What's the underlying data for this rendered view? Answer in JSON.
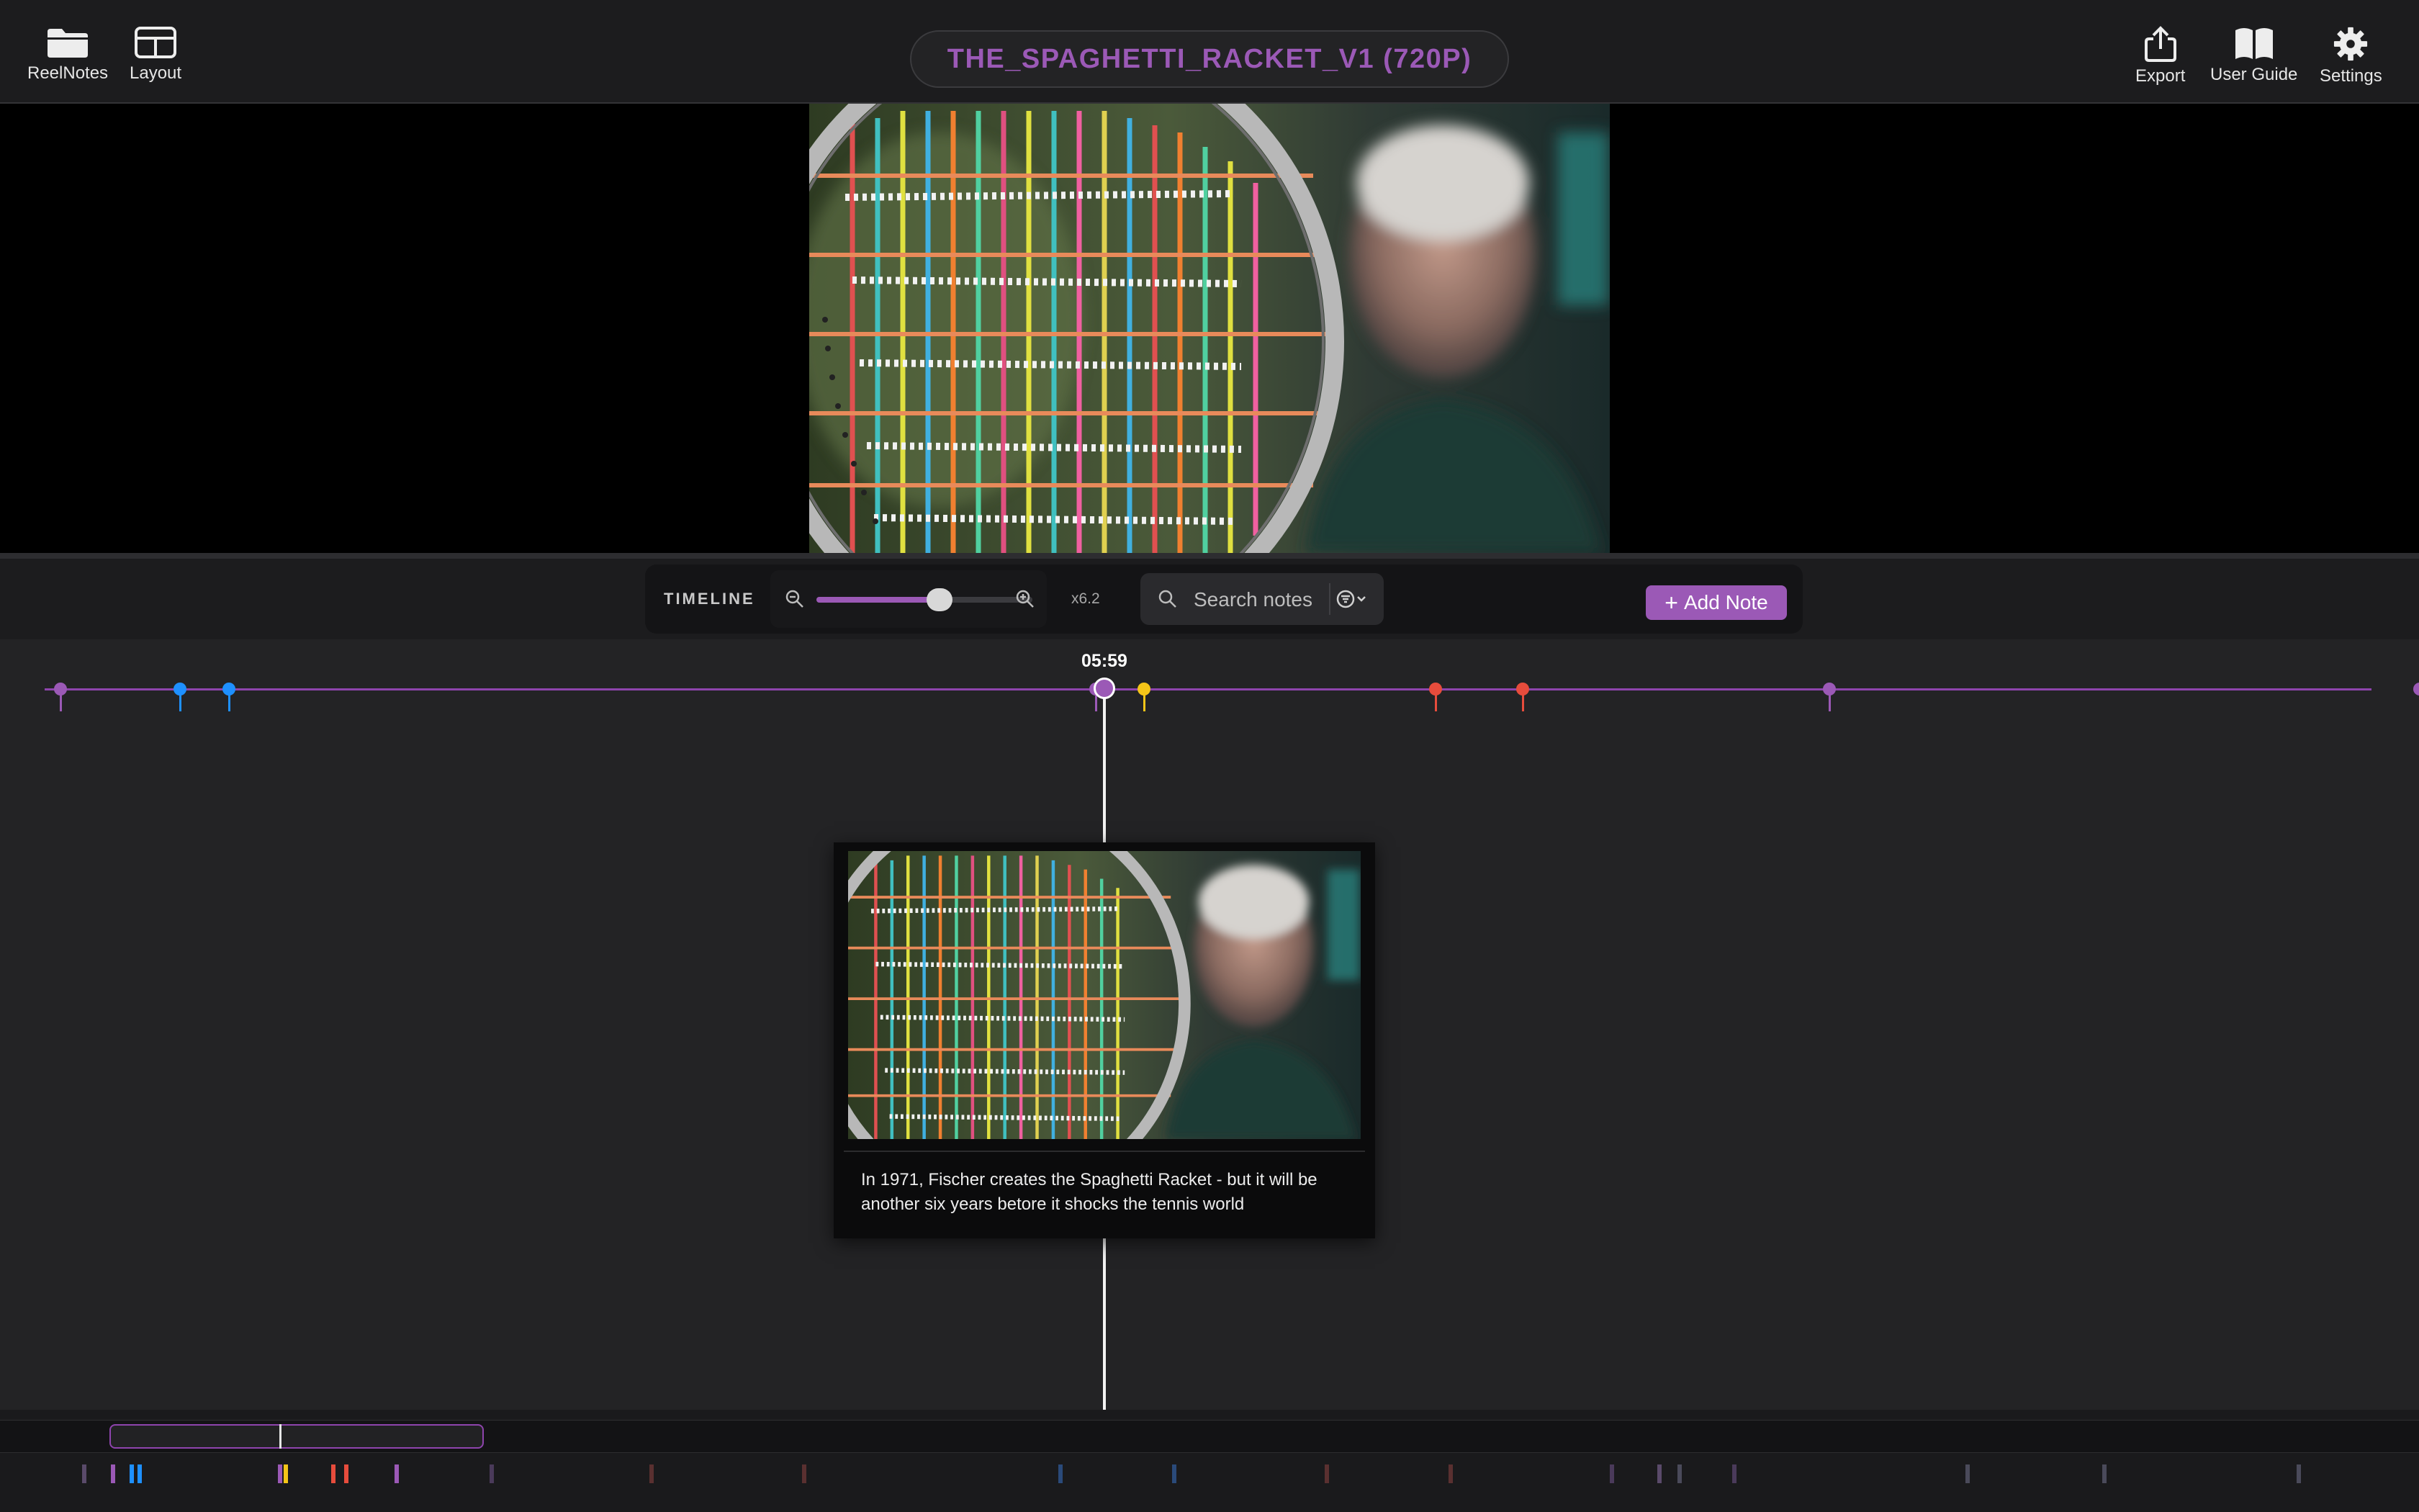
{
  "header": {
    "left_tools": [
      {
        "label": "ReelNotes",
        "icon": "folder-icon"
      },
      {
        "label": "Layout",
        "icon": "layout-icon"
      }
    ],
    "project_title": "THE_SPAGHETTI_RACKET_V1 (720P)",
    "right_tools": [
      {
        "label": "Export",
        "icon": "share-icon"
      },
      {
        "label": "User Guide",
        "icon": "book-icon"
      },
      {
        "label": "Settings",
        "icon": "gear-icon"
      }
    ]
  },
  "viewer": {
    "frame_description_icon": "video-frame"
  },
  "toolbar": {
    "timeline_label": "TIMELINE",
    "zoom_value_label": "x6.2",
    "zoom_level_fraction": 0.57,
    "search_placeholder": "Search notes",
    "add_note_label": "Add Note"
  },
  "timeline": {
    "playhead_time": "05:59",
    "marker_colors": [
      "#9b59b6",
      "#1e90ff",
      "#1e90ff",
      "#9b59b6",
      "#f5c518",
      "#e74c3c",
      "#e74c3c",
      "#9b59b6"
    ],
    "note": {
      "text": "In 1971, Fischer creates the Spaghetti Racket - but it will be another six years betore it shocks the tennis world"
    }
  },
  "colors": {
    "accent": "#9b59b6",
    "blue_marker": "#1e90ff",
    "yellow_marker": "#f5c518",
    "red_marker": "#e74c3c"
  }
}
